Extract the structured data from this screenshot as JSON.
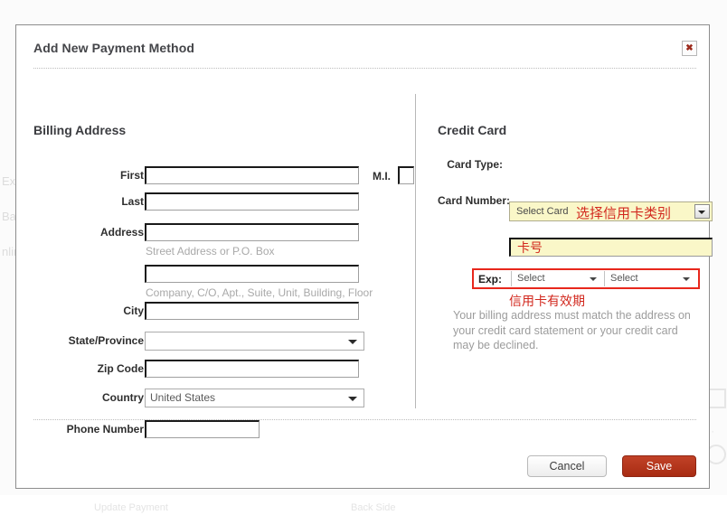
{
  "dialog": {
    "title": "Add New Payment Method",
    "close_icon": "close-x-icon"
  },
  "billing": {
    "section_title": "Billing Address",
    "fields": [
      {
        "label": "First",
        "value": "",
        "hint": ""
      },
      {
        "label": "Last",
        "value": "",
        "hint": ""
      },
      {
        "label": "Address",
        "value": "",
        "hint": "Street Address or P.O. Box"
      },
      {
        "label": "",
        "value": "",
        "hint": "Company, C/O, Apt., Suite, Unit, Building, Floor"
      },
      {
        "label": "City",
        "value": "",
        "hint": ""
      },
      {
        "label": "State/Province",
        "value": "",
        "hint": ""
      },
      {
        "label": "Zip Code",
        "value": "",
        "hint": ""
      },
      {
        "label": "Country",
        "value": "United States",
        "hint": ""
      },
      {
        "label": "Phone Number",
        "value": "",
        "hint": ""
      }
    ],
    "middle_initial_label": "M.I.",
    "middle_initial_value": ""
  },
  "credit_card": {
    "section_title": "Credit Card",
    "card_type_label": "Card Type:",
    "card_type_value": "Select Card",
    "card_type_annotation": "选择信用卡类别",
    "card_number_label": "Card Number:",
    "card_number_value": "卡号",
    "exp_label": "Exp:",
    "exp_month_value": "Select",
    "exp_year_value": "Select",
    "exp_annotation": "信用卡有效期",
    "billing_note": "Your billing address must match the address on your credit card statement or your credit card may be declined."
  },
  "footer": {
    "cancel_label": "Cancel",
    "save_label": "Save"
  },
  "background": {
    "fragments": [
      "Exp",
      "Bag",
      "nlin"
    ],
    "bottom_left": "Update Payment",
    "bottom_right": "Back Side"
  },
  "colors": {
    "save_button": "#b5301a",
    "annotation_red": "#d2281e",
    "highlight_yellow": "#faf7c8",
    "exp_border_red": "#e8271c"
  }
}
